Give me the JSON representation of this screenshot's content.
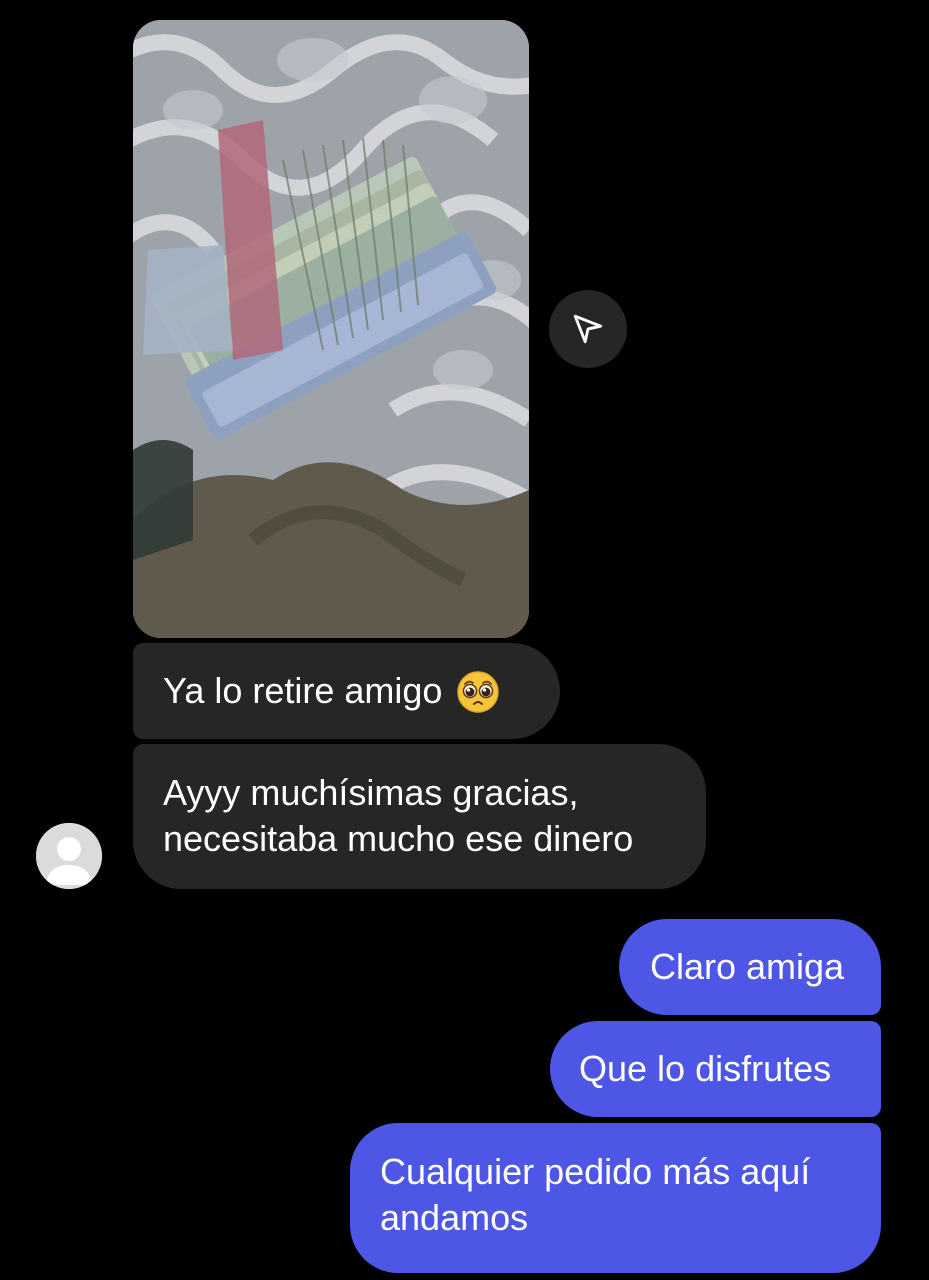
{
  "conversation": {
    "image_message": {
      "description_icon": "photo-attachment",
      "share_icon": "send-paper-plane-icon"
    },
    "messages": [
      {
        "id": "msg1",
        "direction": "incoming",
        "text": "Ya lo retire amigo",
        "emoji": "pleading-face-emoji"
      },
      {
        "id": "msg2",
        "direction": "incoming",
        "line1": "Ayyy muchísimas gracias,",
        "line2": "necesitaba mucho ese dinero"
      },
      {
        "id": "msg3",
        "direction": "outgoing",
        "text": "Claro amiga"
      },
      {
        "id": "msg4",
        "direction": "outgoing",
        "text": "Que lo disfrutes"
      },
      {
        "id": "msg5",
        "direction": "outgoing",
        "line1": "Cualquier pedido más aquí",
        "line2": "andamos"
      }
    ],
    "avatar_icon": "default-user-avatar-icon"
  },
  "colors": {
    "background": "#000000",
    "incoming_bubble": "#262626",
    "outgoing_bubble": "#4e56e6",
    "text": "#ffffff"
  }
}
